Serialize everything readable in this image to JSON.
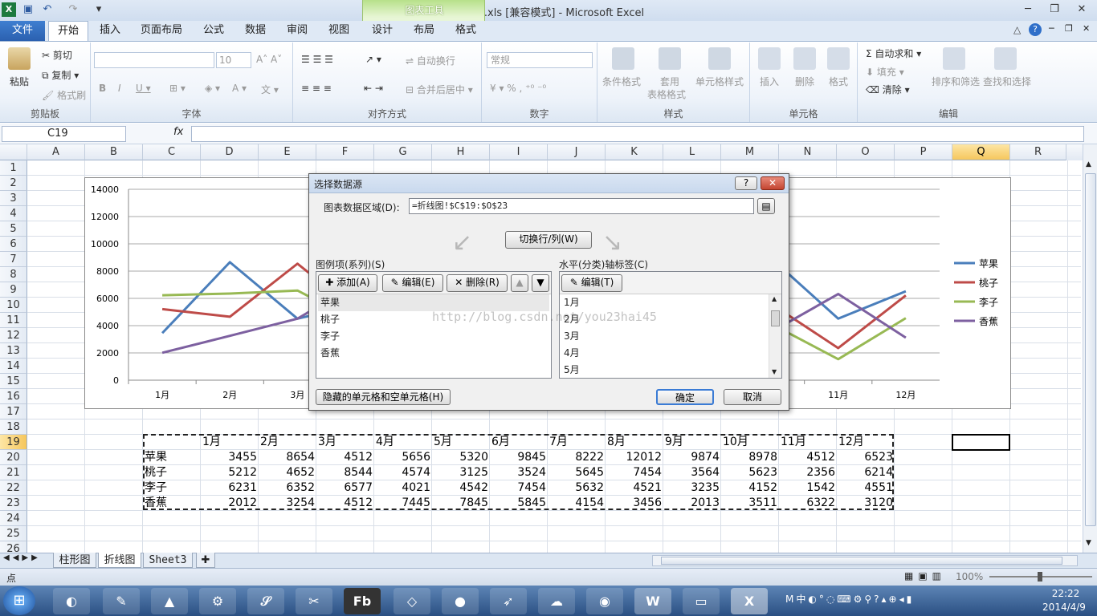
{
  "window": {
    "title": "柱形图.xls  [兼容模式] - Microsoft Excel",
    "chart_tools": "图表工具"
  },
  "tabs": [
    "文件",
    "开始",
    "插入",
    "页面布局",
    "公式",
    "数据",
    "审阅",
    "视图",
    "设计",
    "布局",
    "格式"
  ],
  "ribbon": {
    "clipboard": {
      "label": "剪贴板",
      "paste": "粘贴",
      "cut": "剪切",
      "copy": "复制",
      "format_painter": "格式刷"
    },
    "font": {
      "label": "字体",
      "size": "10"
    },
    "alignment": {
      "label": "对齐方式",
      "wrap": "自动换行",
      "merge": "合并后居中"
    },
    "number": {
      "label": "数字",
      "format": "常规"
    },
    "styles": {
      "label": "样式",
      "conditional": "条件格式",
      "table_l1": "套用",
      "table_l2": "表格格式",
      "cell_styles": "单元格样式"
    },
    "cells": {
      "label": "单元格",
      "insert": "插入",
      "delete": "删除",
      "format": "格式"
    },
    "editing": {
      "label": "编辑",
      "autosum": "自动求和",
      "fill": "填充",
      "clear": "清除",
      "sort": "排序和筛选",
      "find": "查找和选择"
    }
  },
  "formula_bar": {
    "name_box": "C19",
    "fx": "fx",
    "value": ""
  },
  "columns": [
    "A",
    "B",
    "C",
    "D",
    "E",
    "F",
    "G",
    "H",
    "I",
    "J",
    "K",
    "L",
    "M",
    "N",
    "O",
    "P",
    "Q",
    "R"
  ],
  "rows": [
    "1",
    "2",
    "3",
    "4",
    "5",
    "6",
    "7",
    "8",
    "9",
    "10",
    "11",
    "12",
    "13",
    "14",
    "15",
    "16",
    "17",
    "18",
    "19",
    "20",
    "21",
    "22",
    "23",
    "24",
    "25",
    "26"
  ],
  "table": {
    "months": [
      "1月",
      "2月",
      "3月",
      "4月",
      "5月",
      "6月",
      "7月",
      "8月",
      "9月",
      "10月",
      "11月",
      "12月"
    ],
    "data": [
      {
        "name": "苹果",
        "values": [
          3455,
          8654,
          4512,
          5656,
          5320,
          9845,
          8222,
          12012,
          9874,
          8978,
          4512,
          6523
        ]
      },
      {
        "name": "桃子",
        "values": [
          5212,
          4652,
          8544,
          4574,
          3125,
          3524,
          5645,
          7454,
          3564,
          5623,
          2356,
          6214
        ]
      },
      {
        "name": "李子",
        "values": [
          6231,
          6352,
          6577,
          4021,
          4542,
          7454,
          5632,
          4521,
          3235,
          4152,
          1542,
          4551
        ]
      },
      {
        "name": "香蕉",
        "values": [
          2012,
          3254,
          4512,
          7445,
          7845,
          5845,
          4154,
          3456,
          2013,
          3511,
          6322,
          3120
        ]
      }
    ]
  },
  "chart_data": {
    "type": "line",
    "categories": [
      "1月",
      "2月",
      "3月",
      "4月",
      "5月",
      "6月",
      "7月",
      "8月",
      "9月",
      "10月",
      "11月",
      "12月"
    ],
    "series": [
      {
        "name": "苹果",
        "color": "#4a7ebb",
        "values": [
          3455,
          8654,
          4512,
          5656,
          5320,
          9845,
          8222,
          12012,
          9874,
          8978,
          4512,
          6523
        ]
      },
      {
        "name": "桃子",
        "color": "#be4b48",
        "values": [
          5212,
          4652,
          8544,
          4574,
          3125,
          3524,
          5645,
          7454,
          3564,
          5623,
          2356,
          6214
        ]
      },
      {
        "name": "李子",
        "color": "#98b954",
        "values": [
          6231,
          6352,
          6577,
          4021,
          4542,
          7454,
          5632,
          4521,
          3235,
          4152,
          1542,
          4551
        ]
      },
      {
        "name": "香蕉",
        "color": "#7d60a0",
        "values": [
          2012,
          3254,
          4512,
          7445,
          7845,
          5845,
          4154,
          3456,
          2013,
          3511,
          6322,
          3120
        ]
      }
    ],
    "yticks": [
      "0",
      "2000",
      "4000",
      "6000",
      "8000",
      "10000",
      "12000",
      "14000"
    ],
    "ylim": [
      0,
      14000
    ],
    "legend": "right",
    "grid": true
  },
  "dialog": {
    "title": "选择数据源",
    "range_label": "图表数据区域(D):",
    "range_value": "=折线图!$C$19:$O$23",
    "switch": "切换行/列(W)",
    "legend_label": "图例项(系列)(S)",
    "axis_label": "水平(分类)轴标签(C)",
    "add": "添加(A)",
    "edit": "编辑(E)",
    "delete": "删除(R)",
    "axis_edit": "编辑(T)",
    "series": [
      "苹果",
      "桃子",
      "李子",
      "香蕉"
    ],
    "categories": [
      "1月",
      "2月",
      "3月",
      "4月",
      "5月"
    ],
    "hidden_cells": "隐藏的单元格和空单元格(H)",
    "ok": "确定",
    "cancel": "取消",
    "help": "?",
    "close": "✕"
  },
  "watermark": "http://blog.csdn.net/you23hai45",
  "sheets": [
    "柱形图",
    "折线图",
    "Sheet3"
  ],
  "status": {
    "mode": "点",
    "zoom": "100%"
  },
  "taskbar": {
    "time": "22:22",
    "date": "2014/4/9"
  }
}
